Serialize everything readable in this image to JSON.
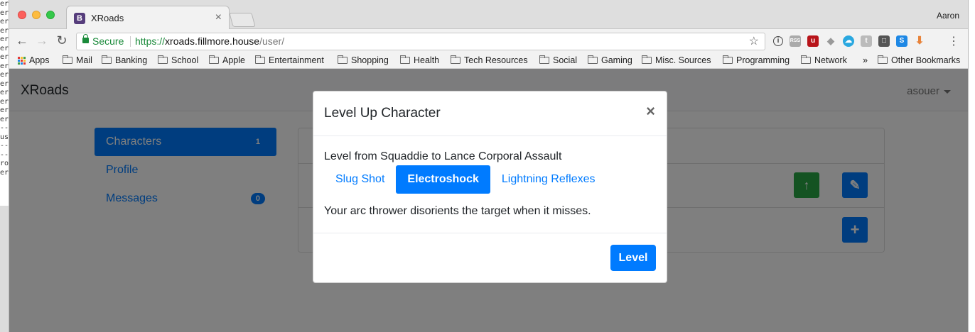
{
  "browser": {
    "tab_title": "XRoads",
    "tab_favicon": "B",
    "profile_name": "Aaron",
    "secure_label": "Secure",
    "url_protocol": "https://",
    "url_host": "xroads.fillmore.house",
    "url_path": "/user/",
    "bookmarks": [
      "Apps",
      "Mail",
      "Banking",
      "School",
      "Apple",
      "Entertainment",
      "Shopping",
      "Health",
      "Tech Resources",
      "Social",
      "Gaming",
      "Misc. Sources",
      "Programming",
      "Network"
    ],
    "bookmarks_overflow": "»",
    "other_bookmarks": "Other Bookmarks"
  },
  "navbar": {
    "brand": "XRoads",
    "user": "asouer"
  },
  "sidebar": {
    "items": [
      {
        "label": "Characters",
        "badge": "1"
      },
      {
        "label": "Profile",
        "badge": ""
      },
      {
        "label": "Messages",
        "badge": "0"
      }
    ]
  },
  "modal": {
    "title": "Level Up Character",
    "close": "×",
    "level_text": "Level from Squaddie to Lance Corporal Assault",
    "options": [
      {
        "label": "Slug Shot"
      },
      {
        "label": "Electroshock",
        "selected": true
      },
      {
        "label": "Lightning Reflexes"
      }
    ],
    "description": "Your arc thrower disorients the target when it misses.",
    "submit_label": "Level"
  },
  "colors": {
    "primary": "#007bff",
    "success": "#28a745",
    "secure_green": "#1a8a3a"
  }
}
